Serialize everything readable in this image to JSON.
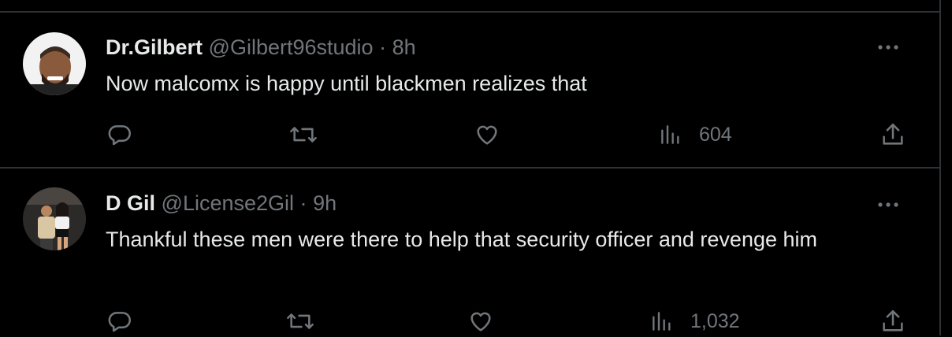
{
  "tweets": [
    {
      "name": "Dr.Gilbert",
      "handle": "@Gilbert96studio",
      "separator": "·",
      "time": "8h",
      "text": "Now malcomx is happy until blackmen realizes that",
      "views": "604"
    },
    {
      "name": "D Gil",
      "handle": "@License2Gil",
      "separator": "·",
      "time": "9h",
      "text": "Thankful these men were there to help that security officer and revenge him",
      "views": "1,032"
    }
  ],
  "icons": {
    "reply": "reply-icon",
    "retweet": "retweet-icon",
    "like": "heart-icon",
    "views": "views-bar-chart-icon",
    "share": "share-icon",
    "more": "more-dots-icon"
  },
  "colors": {
    "background": "#000000",
    "text_primary": "#e7e9ea",
    "text_secondary": "#71767b",
    "divider": "#2f3336"
  }
}
